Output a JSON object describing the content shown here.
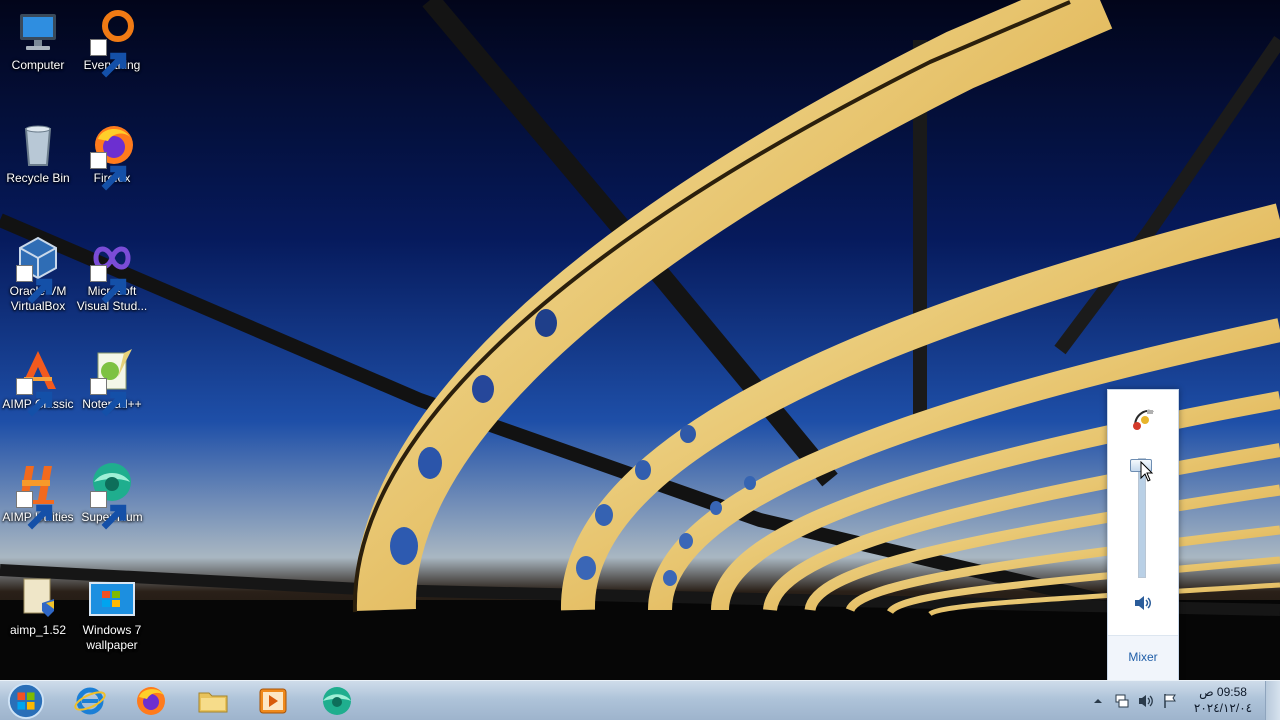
{
  "desktop": {
    "icons": [
      {
        "label_1": "Computer",
        "label_2": "",
        "icon": "computer-icon",
        "shortcut": false
      },
      {
        "label_1": "Everything",
        "label_2": "",
        "icon": "everything-icon",
        "shortcut": true
      },
      {
        "label_1": "Recycle Bin",
        "label_2": "",
        "icon": "recycle-bin-icon",
        "shortcut": false
      },
      {
        "label_1": "Firefox",
        "label_2": "",
        "icon": "firefox-icon",
        "shortcut": true
      },
      {
        "label_1": "Oracle VM",
        "label_2": "VirtualBox",
        "icon": "virtualbox-icon",
        "shortcut": true
      },
      {
        "label_1": "Microsoft",
        "label_2": "Visual Stud...",
        "icon": "visual-studio-icon",
        "shortcut": true
      },
      {
        "label_1": "AIMP Classic",
        "label_2": "",
        "icon": "aimp-classic-icon",
        "shortcut": true
      },
      {
        "label_1": "Notepad++",
        "label_2": "",
        "icon": "notepad-plus-plus-icon",
        "shortcut": true
      },
      {
        "label_1": "AIMP Utilities",
        "label_2": "",
        "icon": "aimp-utilities-icon",
        "shortcut": true
      },
      {
        "label_1": "Supermium",
        "label_2": "",
        "icon": "supermium-icon",
        "shortcut": true
      },
      {
        "label_1": "aimp_1.52",
        "label_2": "",
        "icon": "installer-icon",
        "shortcut": false
      },
      {
        "label_1": "Windows 7",
        "label_2": "wallpaper",
        "icon": "image-file-icon",
        "shortcut": false
      }
    ]
  },
  "volume_flyout": {
    "device_icon": "speaker-device-icon",
    "level_fraction": 0.95,
    "mute_icon": "speaker-icon",
    "mixer_label": "Mixer"
  },
  "taskbar": {
    "start_icon": "windows-start-icon",
    "pinned": [
      {
        "name": "internet-explorer-icon"
      },
      {
        "name": "firefox-icon"
      },
      {
        "name": "file-explorer-icon"
      },
      {
        "name": "media-player-icon"
      },
      {
        "name": "supermium-icon"
      }
    ],
    "tray": {
      "overflow_icon": "show-hidden-icons-icon",
      "network_icon": "network-icon",
      "volume_icon": "volume-icon",
      "flag_icon": "action-center-flag-icon"
    },
    "clock": {
      "time": "09:58 ص",
      "date": "٢٠٢٤/١٢/٠٤"
    }
  },
  "colors": {
    "taskbar_top": "#cfdcea",
    "taskbar_bottom": "#9db3cc",
    "mixer_link": "#1f5ea8"
  }
}
